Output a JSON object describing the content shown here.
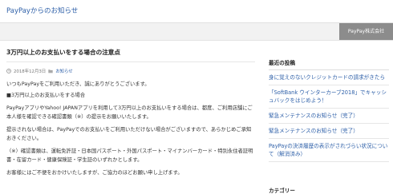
{
  "header": {
    "site_title": "PayPayからのお知らせ",
    "company_button": "PayPay株式会社"
  },
  "post": {
    "title": "3万円以上のお支払いをする場合の注意点",
    "date": "2018年12月3日",
    "category": "お知らせ",
    "paragraphs": {
      "greeting": "いつもPayPayをご利用いただき、誠にありがとうございます。",
      "heading": "■3万円以上のお支払いをする場合",
      "p1": "PayPayアプリやYahoo! JAPANアプリを利用して3万円以上のお支払いをする場合は、都度、ご利用店舗にご本人様を確認できる確認書類（※）の提示をお願いいたします。",
      "p2": "提示されない場合は、PayPayでのお支払いをご利用いただけない場合がございますので、あらかじめご承知おきください。",
      "p3": "（※）確認書類は、運転免許証・日本国パスポート・外国パスポート・マイナンバーカード・特別永住者証明書・在留カード・健康保険証・学生証のいずれかとします。",
      "p4": "お客様にはご不便をおかけいたしますが、ご協力のほどお願い申し上げます。"
    }
  },
  "sidebar": {
    "recent_title": "最近の投稿",
    "recent_posts": [
      "身に覚えのないクレジットカードの請求がきたら",
      "「SoftBank ウインターカーブ2018」でキャッシュバックをはじめよう！",
      "緊急メンテナンスのお知らせ（完了）",
      "緊急メンテナンスのお知らせ（完了）",
      "PayPayの決済履歴の表示がされづらい状況について（解消済み）"
    ],
    "category_title": "カテゴリー"
  },
  "colors": {
    "link": "#2d5fa8",
    "company_button_bg": "#8c8c8c",
    "navbar_bg": "#f2f2f2"
  }
}
